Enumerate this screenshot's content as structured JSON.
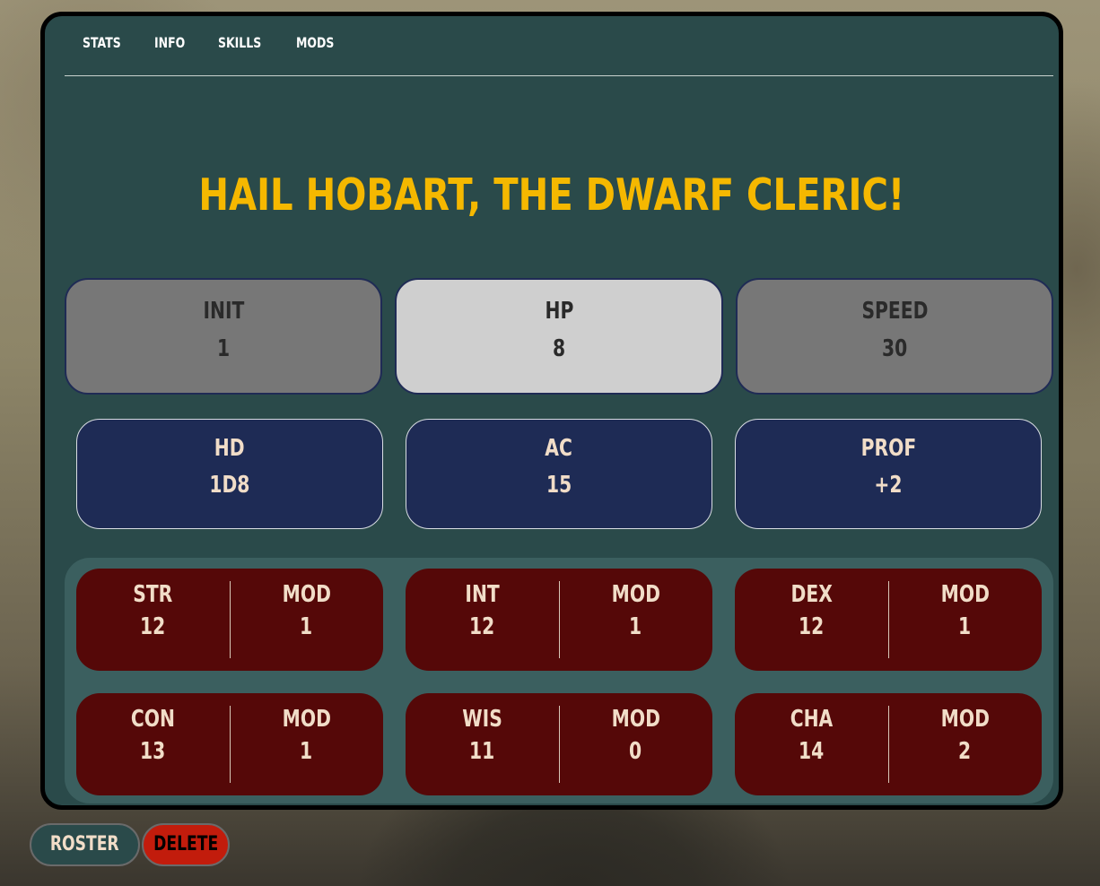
{
  "tabs": [
    "STATS",
    "INFO",
    "SKILLS",
    "MODS"
  ],
  "title": "HAIL HOBART, THE DWARF CLERIC!",
  "top_stats": [
    {
      "label": "INIT",
      "value": "1"
    },
    {
      "label": "HP",
      "value": "8"
    },
    {
      "label": "SPEED",
      "value": "30"
    }
  ],
  "mid_stats": [
    {
      "label": "HD",
      "value": "1D8"
    },
    {
      "label": "AC",
      "value": "15"
    },
    {
      "label": "PROF",
      "value": "+2"
    }
  ],
  "abilities": [
    {
      "label": "STR",
      "value": "12",
      "mod_label": "MOD",
      "mod": "1"
    },
    {
      "label": "INT",
      "value": "12",
      "mod_label": "MOD",
      "mod": "1"
    },
    {
      "label": "DEX",
      "value": "12",
      "mod_label": "MOD",
      "mod": "1"
    },
    {
      "label": "CON",
      "value": "13",
      "mod_label": "MOD",
      "mod": "1"
    },
    {
      "label": "WIS",
      "value": "11",
      "mod_label": "MOD",
      "mod": "0"
    },
    {
      "label": "CHA",
      "value": "14",
      "mod_label": "MOD",
      "mod": "2"
    }
  ],
  "buttons": {
    "roster": "ROSTER",
    "delete": "DELETE"
  },
  "colors": {
    "panel": "#2a4a4a",
    "title": "#f5b800",
    "navy_tile": "#1e2b55",
    "ability_tile": "#550808",
    "delete_button": "#c21c0c"
  }
}
